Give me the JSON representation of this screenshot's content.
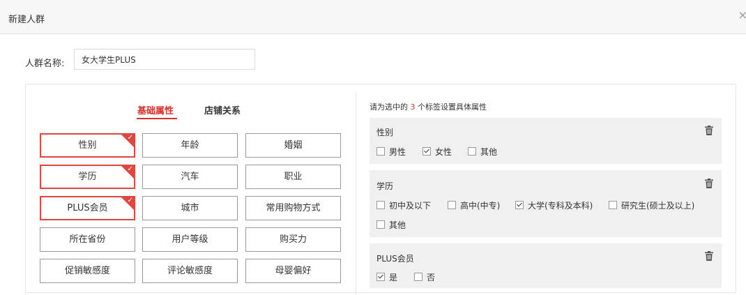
{
  "header": {
    "title": "新建人群",
    "close": "×"
  },
  "name_field": {
    "label": "人群名称:",
    "value": "女大学生PLUS"
  },
  "tabs": {
    "basic": "基础属性",
    "store": "店铺关系"
  },
  "tags": {
    "gender": "性别",
    "age": "年龄",
    "marriage": "婚姻",
    "education": "学历",
    "car": "汽车",
    "job": "职业",
    "plus": "PLUS会员",
    "city": "城市",
    "shopping": "常用购物方式",
    "province": "所在省份",
    "level": "用户等级",
    "purchase": "购买力",
    "promo": "促销敏感度",
    "comment": "评论敏感度",
    "baby": "母婴偏好"
  },
  "selected_tags": [
    "性别",
    "学历",
    "PLUS会员"
  ],
  "hint": {
    "prefix": "请为选中的 ",
    "count": "3",
    "suffix": " 个标签设置具体属性"
  },
  "attributes": {
    "gender": {
      "title": "性别",
      "options": [
        {
          "label": "男性",
          "checked": false
        },
        {
          "label": "女性",
          "checked": true
        },
        {
          "label": "其他",
          "checked": false
        }
      ]
    },
    "education": {
      "title": "学历",
      "options": [
        {
          "label": "初中及以下",
          "checked": false
        },
        {
          "label": "高中(中专)",
          "checked": false
        },
        {
          "label": "大学(专科及本科)",
          "checked": true
        },
        {
          "label": "研究生(硕士及以上)",
          "checked": false
        },
        {
          "label": "其他",
          "checked": false
        }
      ]
    },
    "plus": {
      "title": "PLUS会员",
      "options": [
        {
          "label": "是",
          "checked": true
        },
        {
          "label": "否",
          "checked": false
        }
      ]
    }
  },
  "colors": {
    "accent": "#d9312b",
    "tag_selected_border": "#e1473f",
    "attr_bg": "#f0f0f0"
  },
  "icons": {
    "delete": "trash-icon",
    "selected_corner": "check-icon",
    "close": "close-icon"
  }
}
